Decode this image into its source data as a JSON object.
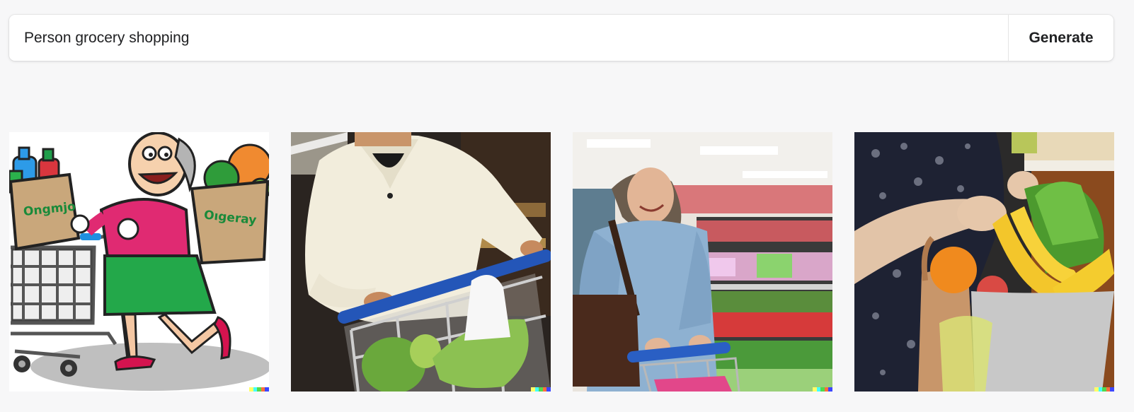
{
  "prompt": {
    "value": "Person grocery shopping",
    "placeholder": "Person grocery shopping"
  },
  "generate_button": {
    "label": "Generate"
  },
  "results": [
    {
      "description_icon": "image-cartoon-grandma-cart",
      "bag_left_text": "Ongmjo",
      "bag_right_text": "Oıgeray"
    },
    {
      "description_icon": "image-man-pushing-cart"
    },
    {
      "description_icon": "image-woman-in-store-aisle"
    },
    {
      "description_icon": "image-bag-of-produce"
    }
  ],
  "watermark_colors": [
    "#ffff66",
    "#42ffff",
    "#51da4c",
    "#ff6e3c",
    "#3c46ff"
  ],
  "colors": {
    "background": "#f7f7f8",
    "text": "#202123"
  }
}
